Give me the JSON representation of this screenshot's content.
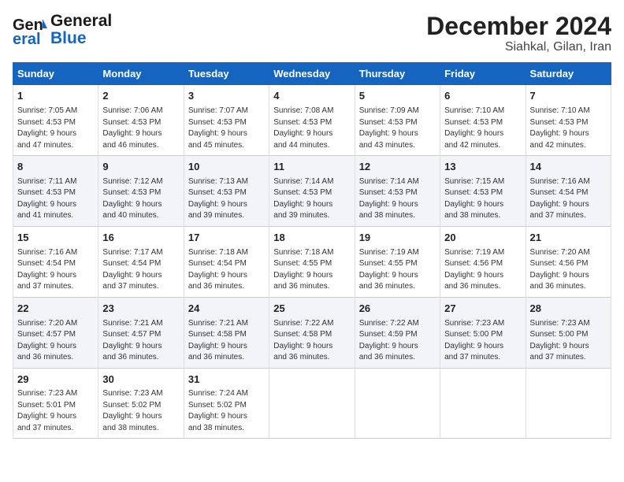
{
  "logo": {
    "line1": "General",
    "line2": "Blue"
  },
  "title": "December 2024",
  "subtitle": "Siahkal, Gilan, Iran",
  "days_of_week": [
    "Sunday",
    "Monday",
    "Tuesday",
    "Wednesday",
    "Thursday",
    "Friday",
    "Saturday"
  ],
  "weeks": [
    [
      {
        "day": 1,
        "info": "Sunrise: 7:05 AM\nSunset: 4:53 PM\nDaylight: 9 hours\nand 47 minutes."
      },
      {
        "day": 2,
        "info": "Sunrise: 7:06 AM\nSunset: 4:53 PM\nDaylight: 9 hours\nand 46 minutes."
      },
      {
        "day": 3,
        "info": "Sunrise: 7:07 AM\nSunset: 4:53 PM\nDaylight: 9 hours\nand 45 minutes."
      },
      {
        "day": 4,
        "info": "Sunrise: 7:08 AM\nSunset: 4:53 PM\nDaylight: 9 hours\nand 44 minutes."
      },
      {
        "day": 5,
        "info": "Sunrise: 7:09 AM\nSunset: 4:53 PM\nDaylight: 9 hours\nand 43 minutes."
      },
      {
        "day": 6,
        "info": "Sunrise: 7:10 AM\nSunset: 4:53 PM\nDaylight: 9 hours\nand 42 minutes."
      },
      {
        "day": 7,
        "info": "Sunrise: 7:10 AM\nSunset: 4:53 PM\nDaylight: 9 hours\nand 42 minutes."
      }
    ],
    [
      {
        "day": 8,
        "info": "Sunrise: 7:11 AM\nSunset: 4:53 PM\nDaylight: 9 hours\nand 41 minutes."
      },
      {
        "day": 9,
        "info": "Sunrise: 7:12 AM\nSunset: 4:53 PM\nDaylight: 9 hours\nand 40 minutes."
      },
      {
        "day": 10,
        "info": "Sunrise: 7:13 AM\nSunset: 4:53 PM\nDaylight: 9 hours\nand 39 minutes."
      },
      {
        "day": 11,
        "info": "Sunrise: 7:14 AM\nSunset: 4:53 PM\nDaylight: 9 hours\nand 39 minutes."
      },
      {
        "day": 12,
        "info": "Sunrise: 7:14 AM\nSunset: 4:53 PM\nDaylight: 9 hours\nand 38 minutes."
      },
      {
        "day": 13,
        "info": "Sunrise: 7:15 AM\nSunset: 4:53 PM\nDaylight: 9 hours\nand 38 minutes."
      },
      {
        "day": 14,
        "info": "Sunrise: 7:16 AM\nSunset: 4:54 PM\nDaylight: 9 hours\nand 37 minutes."
      }
    ],
    [
      {
        "day": 15,
        "info": "Sunrise: 7:16 AM\nSunset: 4:54 PM\nDaylight: 9 hours\nand 37 minutes."
      },
      {
        "day": 16,
        "info": "Sunrise: 7:17 AM\nSunset: 4:54 PM\nDaylight: 9 hours\nand 37 minutes."
      },
      {
        "day": 17,
        "info": "Sunrise: 7:18 AM\nSunset: 4:54 PM\nDaylight: 9 hours\nand 36 minutes."
      },
      {
        "day": 18,
        "info": "Sunrise: 7:18 AM\nSunset: 4:55 PM\nDaylight: 9 hours\nand 36 minutes."
      },
      {
        "day": 19,
        "info": "Sunrise: 7:19 AM\nSunset: 4:55 PM\nDaylight: 9 hours\nand 36 minutes."
      },
      {
        "day": 20,
        "info": "Sunrise: 7:19 AM\nSunset: 4:56 PM\nDaylight: 9 hours\nand 36 minutes."
      },
      {
        "day": 21,
        "info": "Sunrise: 7:20 AM\nSunset: 4:56 PM\nDaylight: 9 hours\nand 36 minutes."
      }
    ],
    [
      {
        "day": 22,
        "info": "Sunrise: 7:20 AM\nSunset: 4:57 PM\nDaylight: 9 hours\nand 36 minutes."
      },
      {
        "day": 23,
        "info": "Sunrise: 7:21 AM\nSunset: 4:57 PM\nDaylight: 9 hours\nand 36 minutes."
      },
      {
        "day": 24,
        "info": "Sunrise: 7:21 AM\nSunset: 4:58 PM\nDaylight: 9 hours\nand 36 minutes."
      },
      {
        "day": 25,
        "info": "Sunrise: 7:22 AM\nSunset: 4:58 PM\nDaylight: 9 hours\nand 36 minutes."
      },
      {
        "day": 26,
        "info": "Sunrise: 7:22 AM\nSunset: 4:59 PM\nDaylight: 9 hours\nand 36 minutes."
      },
      {
        "day": 27,
        "info": "Sunrise: 7:23 AM\nSunset: 5:00 PM\nDaylight: 9 hours\nand 37 minutes."
      },
      {
        "day": 28,
        "info": "Sunrise: 7:23 AM\nSunset: 5:00 PM\nDaylight: 9 hours\nand 37 minutes."
      }
    ],
    [
      {
        "day": 29,
        "info": "Sunrise: 7:23 AM\nSunset: 5:01 PM\nDaylight: 9 hours\nand 37 minutes."
      },
      {
        "day": 30,
        "info": "Sunrise: 7:23 AM\nSunset: 5:02 PM\nDaylight: 9 hours\nand 38 minutes."
      },
      {
        "day": 31,
        "info": "Sunrise: 7:24 AM\nSunset: 5:02 PM\nDaylight: 9 hours\nand 38 minutes."
      },
      null,
      null,
      null,
      null
    ]
  ]
}
